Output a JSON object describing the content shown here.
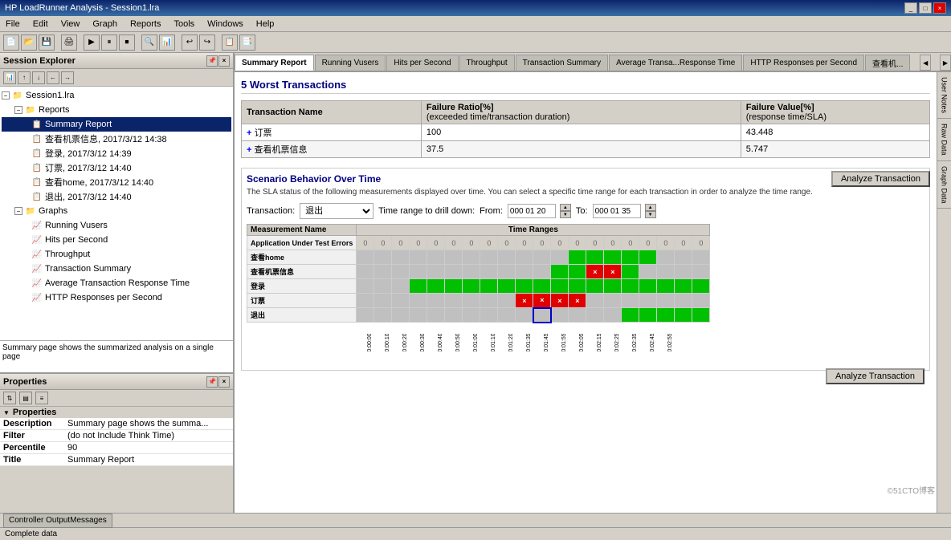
{
  "titleBar": {
    "title": "HP LoadRunner Analysis - Session1.lra",
    "buttons": [
      "_",
      "□",
      "×"
    ]
  },
  "menuBar": {
    "items": [
      "File",
      "Edit",
      "View",
      "Graph",
      "Reports",
      "Tools",
      "Windows",
      "Help"
    ]
  },
  "sessionExplorer": {
    "title": "Session Explorer",
    "tree": {
      "root": "Session1.lra",
      "reports": {
        "label": "Reports",
        "items": [
          "Summary Report",
          "查看机票信息, 2017/3/12 14:38",
          "登录, 2017/3/12 14:39",
          "订票, 2017/3/12 14:40",
          "查看home, 2017/3/12 14:40",
          "退出, 2017/3/12 14:40"
        ]
      },
      "graphs": {
        "label": "Graphs",
        "items": [
          "Running Vusers",
          "Hits per Second",
          "Throughput",
          "Transaction Summary",
          "Average Transaction Response Time",
          "HTTP Responses per Second"
        ]
      }
    }
  },
  "properties": {
    "sectionTitle": "Properties",
    "rows": [
      {
        "key": "Description",
        "value": "Summary page shows the summa..."
      },
      {
        "key": "Filter",
        "value": "(do not Include Think Time)"
      },
      {
        "key": "Percentile",
        "value": "90"
      },
      {
        "key": "Title",
        "value": "Summary Report"
      }
    ]
  },
  "descriptionText": "Summary page shows the summarized analysis on a single page",
  "tabs": [
    "Summary Report",
    "Running Vusers",
    "Hits per Second",
    "Throughput",
    "Transaction Summary",
    "Average Transa...Response Time",
    "HTTP Responses per Second",
    "查看机..."
  ],
  "rightPanels": [
    "User Notes",
    "Raw Data",
    "Graph Data"
  ],
  "summaryReport": {
    "worstTransactions": {
      "title": "5 Worst Transactions",
      "headers": [
        "Transaction Name",
        "Failure Ratio[%]\n(exceeded time/transaction duration)",
        "Failure Value[%]\n(response time/SLA)"
      ],
      "rows": [
        {
          "name": "订票",
          "failureRatio": "100",
          "failureValue": "43.448"
        },
        {
          "name": "查看机票信息",
          "failureRatio": "37.5",
          "failureValue": "5.747"
        }
      ],
      "analyzeBtn": "Analyze Transaction"
    },
    "scenarioBehavior": {
      "title": "Scenario Behavior Over Time",
      "description": "The SLA status of the following measurements displayed over time. You can select a specific time range for each transaction in order to analyze the time range.",
      "transactionLabel": "Transaction:",
      "transactionValue": "退出",
      "timeRangeLabel": "Time range to drill down:",
      "fromLabel": "From:",
      "fromValue": "000 01 20",
      "toLabel": "To:",
      "toValue": "000 01 35",
      "gridHeaders": {
        "measurementName": "Measurement Name",
        "timeRanges": "Time Ranges"
      },
      "rows": [
        {
          "name": "Application Under Test Errors",
          "cells": [
            "0",
            "0",
            "0",
            "0",
            "0",
            "0",
            "0",
            "0",
            "0",
            "0",
            "0",
            "0",
            "0",
            "0",
            "0",
            "0",
            "0",
            "0",
            "0",
            "0"
          ],
          "type": "zero"
        },
        {
          "name": "查看home",
          "cells": [
            "g",
            "g",
            "g",
            "g",
            "g",
            "g",
            "g",
            "g",
            "g",
            "g",
            "g",
            "g",
            "G",
            "G",
            "G",
            "G",
            "g",
            "g",
            "g",
            "g"
          ],
          "type": "mixed"
        },
        {
          "name": "查看机票信息",
          "cells": [
            "g",
            "g",
            "g",
            "g",
            "g",
            "g",
            "g",
            "g",
            "g",
            "g",
            "g",
            "G",
            "G",
            "X",
            "X",
            "G",
            "g",
            "g",
            "g",
            "g"
          ],
          "type": "mixed"
        },
        {
          "name": "登录",
          "cells": [
            "g",
            "g",
            "g",
            "G",
            "G",
            "G",
            "G",
            "G",
            "G",
            "G",
            "G",
            "G",
            "G",
            "G",
            "G",
            "G",
            "G",
            "G",
            "G",
            "G"
          ],
          "type": "green"
        },
        {
          "name": "订票",
          "cells": [
            "g",
            "g",
            "g",
            "g",
            "g",
            "g",
            "g",
            "g",
            "g",
            "X",
            "X",
            "X",
            "X",
            "g",
            "g",
            "g",
            "g",
            "g",
            "g",
            "g"
          ],
          "type": "mixed"
        },
        {
          "name": "退出",
          "cells": [
            "g",
            "g",
            "g",
            "g",
            "g",
            "g",
            "g",
            "g",
            "g",
            "g",
            "S",
            "g",
            "g",
            "g",
            "g",
            "G",
            "G",
            "G",
            "G",
            "G"
          ],
          "type": "mixed"
        }
      ],
      "timeLabels": [
        "0:00:00",
        "0:00:10",
        "0:00:20",
        "0:00:30",
        "0:00:40",
        "0:00:50",
        "0:01:00",
        "0:01:10",
        "0:01:20",
        "0:01:35",
        "0:01:45",
        "0:01:55",
        "0:02:05",
        "0:02:15",
        "0:02:25",
        "0:02:35",
        "0:02:45",
        "0:02:55"
      ],
      "analyzeBtn": "Analyze Transaction"
    }
  },
  "bottomBar": {
    "tab": "Controller OutputMessages",
    "status": "Complete data"
  },
  "watermark": "©51CTO博客"
}
